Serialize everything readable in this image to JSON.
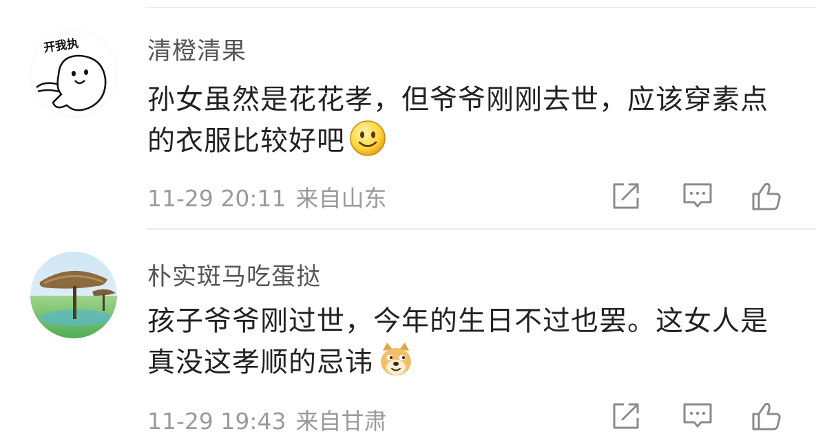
{
  "comments": [
    {
      "username": "清橙清果",
      "text": "孙女虽然是花花孝，但爷爷刚刚去世，应该穿素点的衣服比较好吧",
      "emoji": "smile-emoji",
      "time": "11-29 20:11",
      "location": "来自山东",
      "avatar_text": "开我执"
    },
    {
      "username": "朴实斑马吃蛋挞",
      "text": "孩子爷爷刚过世，今年的生日不过也罢。这女人是真没这孝顺的忌讳",
      "emoji": "doge-emoji",
      "time": "11-29 19:43",
      "location": "来自甘肃"
    }
  ],
  "icons": {
    "share": "share-icon",
    "comment": "comment-icon",
    "like": "thumbs-up-icon"
  },
  "colors": {
    "username": "#555555",
    "text": "#222222",
    "meta": "#9a9a9a",
    "icon": "#8a8a8a",
    "divider": "#ececec"
  }
}
